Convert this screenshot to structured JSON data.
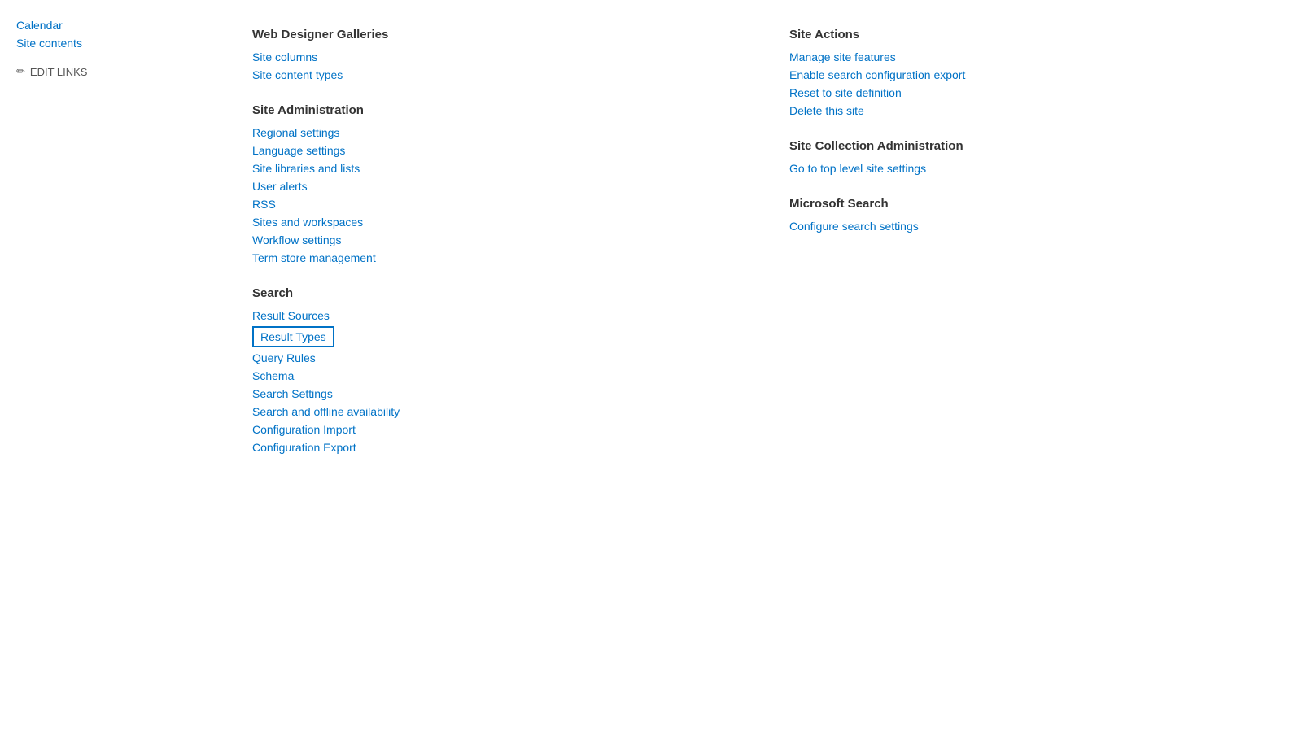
{
  "sidebar": {
    "items": [
      {
        "label": "Calendar",
        "href": "#"
      },
      {
        "label": "Site contents",
        "href": "#"
      }
    ],
    "edit_links_label": "EDIT LINKS"
  },
  "left_column": {
    "sections": [
      {
        "heading": "Web Designer Galleries",
        "links": [
          {
            "label": "Site columns",
            "href": "#"
          },
          {
            "label": "Site content types",
            "href": "#"
          }
        ]
      },
      {
        "heading": "Site Administration",
        "links": [
          {
            "label": "Regional settings",
            "href": "#"
          },
          {
            "label": "Language settings",
            "href": "#"
          },
          {
            "label": "Site libraries and lists",
            "href": "#",
            "highlighted": false
          },
          {
            "label": "User alerts",
            "href": "#"
          },
          {
            "label": "RSS",
            "href": "#"
          },
          {
            "label": "Sites and workspaces",
            "href": "#"
          },
          {
            "label": "Workflow settings",
            "href": "#"
          },
          {
            "label": "Term store management",
            "href": "#"
          }
        ]
      },
      {
        "heading": "Search",
        "links": [
          {
            "label": "Result Sources",
            "href": "#"
          },
          {
            "label": "Result Types",
            "href": "#",
            "highlighted": true
          },
          {
            "label": "Query Rules",
            "href": "#"
          },
          {
            "label": "Schema",
            "href": "#"
          },
          {
            "label": "Search Settings",
            "href": "#"
          },
          {
            "label": "Search and offline availability",
            "href": "#"
          },
          {
            "label": "Configuration Import",
            "href": "#"
          },
          {
            "label": "Configuration Export",
            "href": "#"
          }
        ]
      }
    ]
  },
  "right_column": {
    "sections": [
      {
        "heading": "Site Actions",
        "links": [
          {
            "label": "Manage site features",
            "href": "#"
          },
          {
            "label": "Enable search configuration export",
            "href": "#"
          },
          {
            "label": "Reset to site definition",
            "href": "#"
          },
          {
            "label": "Delete this site",
            "href": "#"
          }
        ]
      },
      {
        "heading": "Site Collection Administration",
        "links": [
          {
            "label": "Go to top level site settings",
            "href": "#"
          }
        ]
      },
      {
        "heading": "Microsoft Search",
        "links": [
          {
            "label": "Configure search settings",
            "href": "#"
          }
        ]
      }
    ]
  }
}
